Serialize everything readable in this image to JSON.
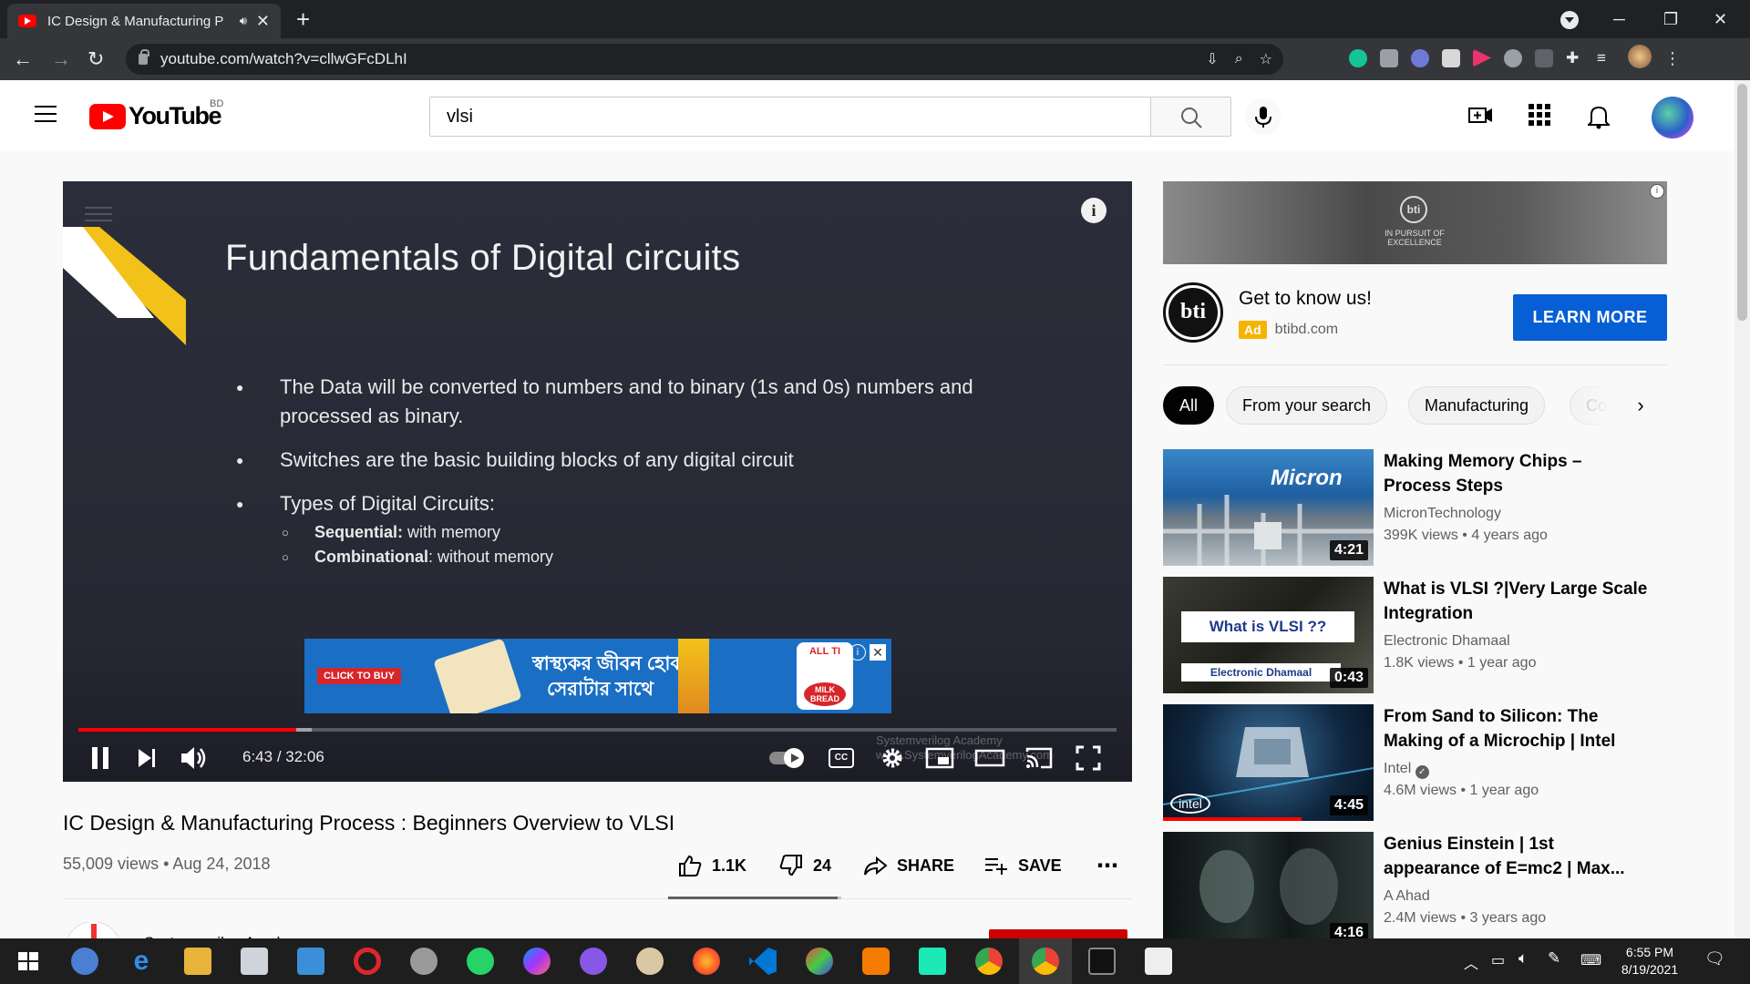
{
  "browser": {
    "tab_title": "IC Design & Manufacturing P",
    "url": "youtube.com/watch?v=cllwGFcDLhI"
  },
  "youtube": {
    "logo_text": "YouTube",
    "country_code": "BD",
    "search_query": "vlsi"
  },
  "player": {
    "slide": {
      "title": "Fundamentals of Digital circuits",
      "bullets": [
        "The Data will be  converted to numbers and to binary (1s and 0s) numbers and processed as binary.",
        "Switches are the basic building blocks of any digital circuit",
        "Types of Digital Circuits:"
      ],
      "sub_bullets": [
        {
          "term": "Sequential:",
          "desc": " with memory"
        },
        {
          "term": "Combinational",
          "desc": ": without memory"
        }
      ]
    },
    "overlay_ad": {
      "cta": "CLICK TO BUY",
      "line1": "স্বাস্থ্যকর জীবন হোক",
      "line2": "সেরাটার সাথে",
      "badge_top": "ALL TI",
      "badge_text": "MILK BREAD"
    },
    "time_current": "6:43",
    "time_separator": " / ",
    "time_total": "32:06",
    "progress_played": 0.2095,
    "progress_buffered": 0.225,
    "watermark_line1": "Systemverilog Academy",
    "watermark_line2": "www.SystemverilogAcademy.com",
    "cc_label": "CC"
  },
  "video": {
    "title": "IC Design & Manufacturing Process : Beginners Overview to VLSI",
    "views": "55,009 views",
    "meta_separator": " • ",
    "date": "Aug 24, 2018",
    "likes": "1.1K",
    "dislikes": "24",
    "share_label": "SHARE",
    "save_label": "SAVE",
    "like_ratio": 0.978,
    "channel_name": "Systemverilog Academy"
  },
  "sidebar_ad": {
    "banner_tag": "IN PURSUIT OF EXCELLENCE",
    "emblem": "bti",
    "headline": "Get to know us!",
    "ad_tag": "Ad",
    "domain": "btibd.com",
    "cta": "LEARN MORE"
  },
  "chips": [
    "All",
    "From your search",
    "Manufacturing",
    "Co"
  ],
  "recommendations": [
    {
      "title": "Making Memory Chips – Process Steps",
      "channel": "MicronTechnology",
      "stats": "399K views • 4 years ago",
      "duration": "4:21",
      "thumb_text": "Micron",
      "verified": false
    },
    {
      "title": "What is VLSI ?|Very Large Scale Integration",
      "channel": "Electronic Dhamaal",
      "stats": "1.8K views • 1 year ago",
      "duration": "0:43",
      "thumb_text": "What is VLSI ??",
      "thumb_sub": "Electronic Dhamaal",
      "verified": false
    },
    {
      "title": "From Sand to Silicon: The Making of a Microchip | Intel",
      "channel": "Intel",
      "stats": "4.6M views • 1 year ago",
      "duration": "4:45",
      "thumb_text": "intel",
      "verified": true,
      "watched": 0.66
    },
    {
      "title": "Genius Einstein | 1st appearance of E=mc2 | Max...",
      "channel": "A Ahad",
      "stats": "2.4M views • 3 years ago",
      "duration": "4:16",
      "verified": false
    }
  ],
  "taskbar": {
    "time": "6:55 PM",
    "date": "8/19/2021"
  },
  "colors": {
    "yt_red": "#ff0000",
    "learn_more_blue": "#065fd4",
    "ad_yellow": "#f5b400",
    "chrome_dark": "#202124"
  }
}
